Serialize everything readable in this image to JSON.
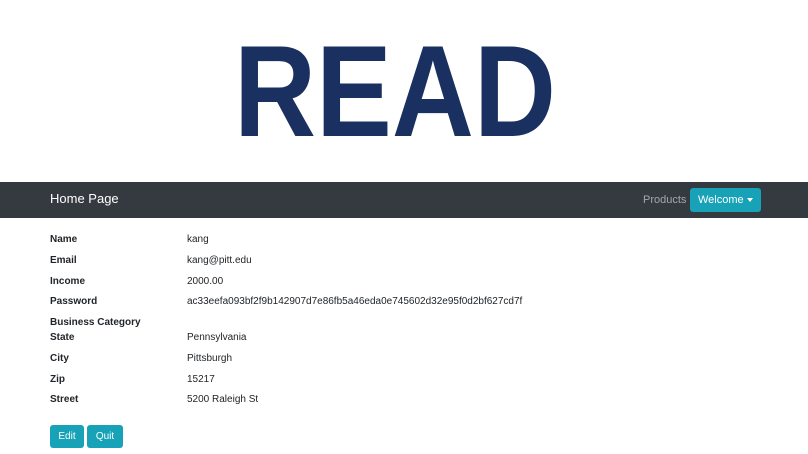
{
  "logo": {
    "text": "READ",
    "color": "#1a3060"
  },
  "navbar": {
    "brand": "Home Page",
    "products_label": "Products",
    "welcome_label": "Welcome",
    "background": "#343a40",
    "accent": "#17a2b8"
  },
  "details": [
    {
      "label": "Name",
      "value": "kang"
    },
    {
      "label": "Email",
      "value": "kang@pitt.edu"
    },
    {
      "label": "Income",
      "value": "2000.00"
    },
    {
      "label": "Password",
      "value": "ac33eefa093bf2f9b142907d7e86fb5a46eda0e745602d32e95f0d2bf627cd7f"
    },
    {
      "label": "Business Category",
      "value": ""
    },
    {
      "label": "State",
      "value": "Pennsylvania"
    },
    {
      "label": "City",
      "value": "Pittsburgh"
    },
    {
      "label": "Zip",
      "value": "15217"
    },
    {
      "label": "Street",
      "value": "5200 Raleigh St"
    }
  ],
  "actions": {
    "edit_label": "Edit",
    "quit_label": "Quit"
  }
}
